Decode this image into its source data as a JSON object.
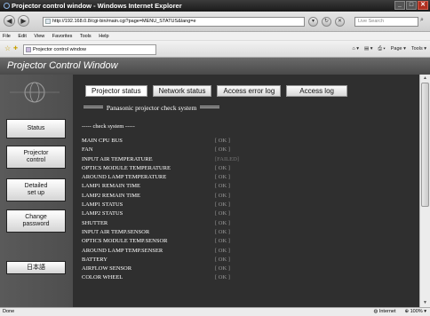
{
  "window": {
    "title": "Projector control window - Windows Internet Explorer",
    "min": "_",
    "max": "□",
    "close": "✕"
  },
  "browser": {
    "back": "◀",
    "forward": "▶",
    "url": "http://192.168.0.8/cgi-bin/main.cgi?page=MENU_STATUS&lang=e",
    "search_placeholder": "Live Search",
    "menu": [
      "File",
      "Edit",
      "View",
      "Favorites",
      "Tools",
      "Help"
    ],
    "tab_title": "Projector control window",
    "tools": [
      "Page ▾",
      "Tools ▾"
    ]
  },
  "app": {
    "title": "Projector Control Window",
    "sidebar": [
      {
        "label": "Status"
      },
      {
        "label": "Projector\ncontrol"
      },
      {
        "label": "Detailed\nset up"
      },
      {
        "label": "Change\npassword"
      },
      {
        "label": "日本語"
      }
    ],
    "tabs": [
      "Projector status",
      "Network status",
      "Access error log",
      "Access log"
    ],
    "panel_title": "Panasonic projector check system",
    "subhead": "----- check system -----",
    "checks": [
      {
        "label": "MAIN CPU BUS",
        "value": "[ OK ]"
      },
      {
        "label": "FAN",
        "value": "[ OK ]"
      },
      {
        "label": "INPUT AIR TEMPERATURE",
        "value": "[FAILED]"
      },
      {
        "label": "OPTICS MODULE TEMPERATURE",
        "value": "[ OK ]"
      },
      {
        "label": "AROUND LAMP TEMPERATURE",
        "value": "[ OK ]"
      },
      {
        "label": "LAMP1 REMAIN TIME",
        "value": "[ OK ]"
      },
      {
        "label": "LAMP2 REMAIN TIME",
        "value": "[ OK ]"
      },
      {
        "label": "LAMP1 STATUS",
        "value": "[ OK ]"
      },
      {
        "label": "LAMP2 STATUS",
        "value": "[ OK ]"
      },
      {
        "label": "SHUTTER",
        "value": "[ OK ]"
      },
      {
        "label": "INPUT AIR TEMP.SENSOR",
        "value": "[ OK ]"
      },
      {
        "label": "OPTICS MODULE TEMP.SENSOR",
        "value": "[ OK ]"
      },
      {
        "label": "AROUND LAMP TEMP.SENSER",
        "value": "[ OK ]"
      },
      {
        "label": "BATTERY",
        "value": "[ OK ]"
      },
      {
        "label": "AIRFLOW SENSOR",
        "value": "[ OK ]"
      },
      {
        "label": "COLOR WHEEL",
        "value": "[ OK ]"
      }
    ]
  },
  "statusbar": {
    "left": "Done",
    "zone": "Internet",
    "zoom": "100%"
  }
}
